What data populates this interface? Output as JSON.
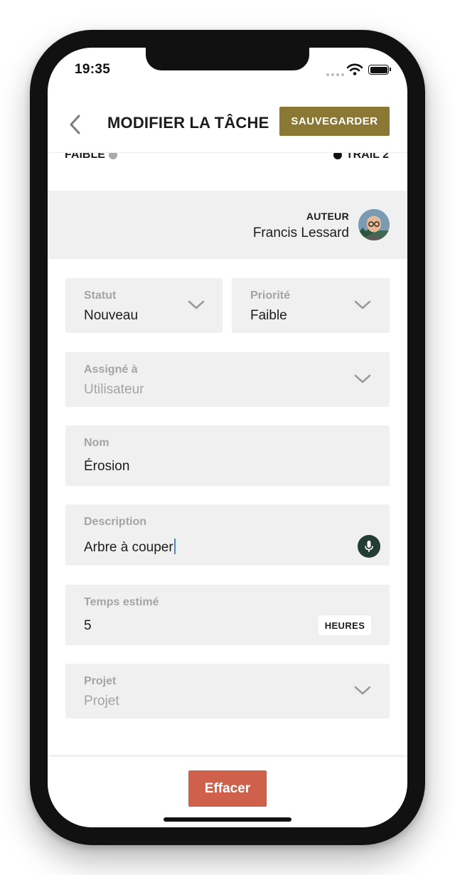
{
  "status_bar": {
    "time": "19:35"
  },
  "header": {
    "title": "MODIFIER LA TÂCHE",
    "save_label": "SAUVEGARDER",
    "back_icon": "chevron-left-icon"
  },
  "summary_row": {
    "priority_text": "FAIBLE",
    "priority_dot_color": "#a9a9a9",
    "trail_text": "TRAIL 2",
    "trail_dot_color": "#111111"
  },
  "author": {
    "label": "AUTEUR",
    "name": "Francis Lessard",
    "avatar_icon": "avatar-illustration"
  },
  "fields": {
    "status": {
      "label": "Statut",
      "value": "Nouveau"
    },
    "priority": {
      "label": "Priorité",
      "value": "Faible"
    },
    "assignee": {
      "label": "Assigné à",
      "placeholder": "Utilisateur"
    },
    "name": {
      "label": "Nom",
      "value": "Érosion"
    },
    "description": {
      "label": "Description",
      "value": "Arbre à couper",
      "mic_icon": "microphone-icon"
    },
    "estimated_time": {
      "label": "Temps estimé",
      "value": "5",
      "unit": "HEURES"
    },
    "project": {
      "label": "Projet",
      "placeholder": "Projet"
    }
  },
  "footer": {
    "delete_label": "Effacer"
  },
  "colors": {
    "accent_gold": "#8b7835",
    "delete_red": "#cf604b",
    "field_bg": "#f0f0f0",
    "mic_bg": "#233c34"
  }
}
